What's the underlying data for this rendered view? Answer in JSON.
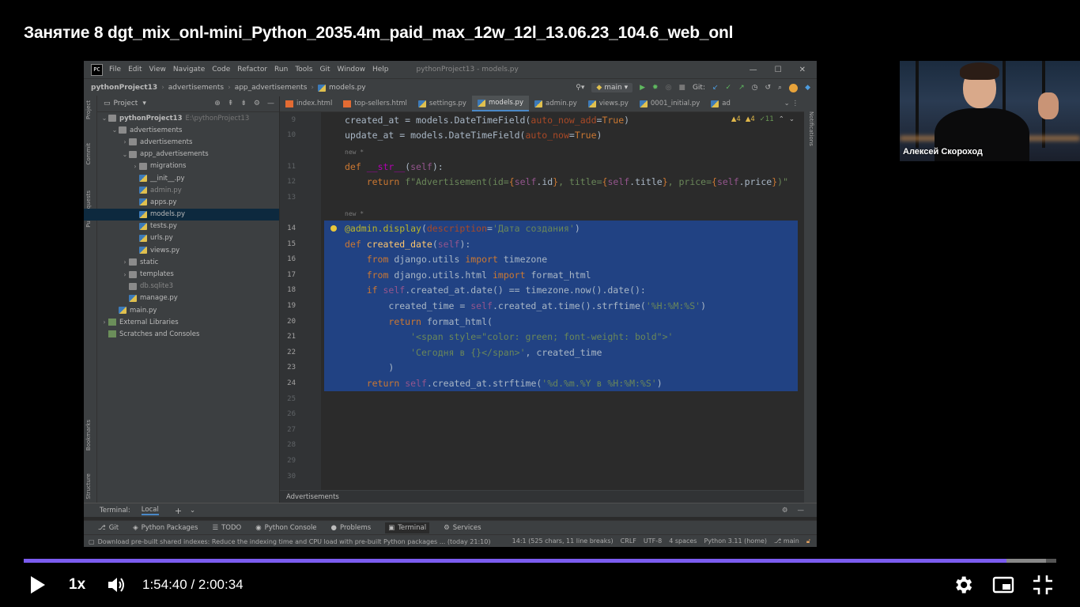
{
  "video": {
    "title": "Занятие 8 dgt_mix_onl-mini_Python_2035.4m_paid_max_12w_12l_13.06.23_104.6_web_onl",
    "speed": "1x",
    "time": "1:54:40 / 2:00:34",
    "progress_fraction": 0.952,
    "accent_color": "#7b5cf0"
  },
  "webcam": {
    "name": "Алексей Скороход"
  },
  "ide": {
    "menu": [
      "File",
      "Edit",
      "View",
      "Navigate",
      "Code",
      "Refactor",
      "Run",
      "Tools",
      "Git",
      "Window",
      "Help"
    ],
    "window_title": "pythonProject13 - models.py",
    "breadcrumbs": [
      "pythonProject13",
      "advertisements",
      "app_advertisements",
      "models.py"
    ],
    "branch": "main",
    "git_label": "Git:",
    "project_label": "Project",
    "left_tabs": [
      "Project",
      "Commit",
      "Pull Requests",
      "Bookmarks",
      "Structure"
    ],
    "right_tab": "Notifications",
    "tree": [
      {
        "label": "pythonProject13",
        "hint": "E:\\pythonProject13",
        "depth": 0,
        "type": "folder",
        "arrow": "v",
        "bold": true
      },
      {
        "label": "advertisements",
        "depth": 1,
        "type": "folder",
        "arrow": "v"
      },
      {
        "label": "advertisements",
        "depth": 2,
        "type": "folder",
        "arrow": ">"
      },
      {
        "label": "app_advertisements",
        "depth": 2,
        "type": "folder",
        "arrow": "v"
      },
      {
        "label": "migrations",
        "depth": 3,
        "type": "folder",
        "arrow": ">"
      },
      {
        "label": "__init__.py",
        "depth": 3,
        "type": "py"
      },
      {
        "label": "admin.py",
        "depth": 3,
        "type": "py",
        "grey": true
      },
      {
        "label": "apps.py",
        "depth": 3,
        "type": "py"
      },
      {
        "label": "models.py",
        "depth": 3,
        "type": "py",
        "selected": true
      },
      {
        "label": "tests.py",
        "depth": 3,
        "type": "py"
      },
      {
        "label": "urls.py",
        "depth": 3,
        "type": "py"
      },
      {
        "label": "views.py",
        "depth": 3,
        "type": "py"
      },
      {
        "label": "static",
        "depth": 2,
        "type": "folder",
        "arrow": ">"
      },
      {
        "label": "templates",
        "depth": 2,
        "type": "folder",
        "arrow": ">"
      },
      {
        "label": "db.sqlite3",
        "depth": 2,
        "type": "db",
        "grey": true
      },
      {
        "label": "manage.py",
        "depth": 2,
        "type": "py"
      },
      {
        "label": "main.py",
        "depth": 1,
        "type": "py"
      },
      {
        "label": "External Libraries",
        "depth": 0,
        "type": "lib",
        "arrow": ">"
      },
      {
        "label": "Scratches and Consoles",
        "depth": 0,
        "type": "lib"
      }
    ],
    "tabs": [
      {
        "label": "index.html",
        "kind": "html"
      },
      {
        "label": "top-sellers.html",
        "kind": "html"
      },
      {
        "label": "settings.py",
        "kind": "py"
      },
      {
        "label": "models.py",
        "kind": "py",
        "active": true
      },
      {
        "label": "admin.py",
        "kind": "py"
      },
      {
        "label": "views.py",
        "kind": "py"
      },
      {
        "label": "0001_initial.py",
        "kind": "py"
      },
      {
        "label": "ad",
        "kind": "py"
      }
    ],
    "inspections": {
      "warn1": "▲4",
      "warn2": "▲4",
      "ok": "✓11"
    },
    "code_lines": [
      {
        "n": "9",
        "html": "created_at = models.DateTimeField(<span class=\"param\">auto_now_add</span>=<span class=\"kw\">True</span>)"
      },
      {
        "n": "10",
        "html": "update_at = models.DateTimeField(<span class=\"param\">auto_now</span>=<span class=\"kw\">True</span>)"
      },
      {
        "n": "",
        "html": "<span class=\"inlay\">new *</span>"
      },
      {
        "n": "11",
        "html": "<span class=\"kw\">def</span> <span class=\"dunder\">__str__</span>(<span class=\"self\">self</span>):"
      },
      {
        "n": "12",
        "html": "    <span class=\"kw\">return</span> <span class=\"str\">f\"Advertisement(id=</span><span class=\"kw\">{</span><span class=\"self\">self</span>.id<span class=\"kw\">}</span><span class=\"str\">, title=</span><span class=\"kw\">{</span><span class=\"self\">self</span>.title<span class=\"kw\">}</span><span class=\"str\">, price=</span><span class=\"kw\">{</span><span class=\"self\">self</span>.price<span class=\"kw\">}</span><span class=\"str\">)\"</span>"
      },
      {
        "n": "13",
        "html": ""
      },
      {
        "n": "",
        "html": "<span class=\"inlay\">new *</span>"
      },
      {
        "n": "14",
        "html": "<span class=\"dec\">@admin.display</span>(<span class=\"param\">description</span>=<span class=\"str\">'Дата создания'</span>)",
        "hl": true,
        "bulb": true
      },
      {
        "n": "15",
        "html": "<span class=\"kw\">def</span> <span class=\"fn\">created_date</span>(<span class=\"self\">self</span>):",
        "hl": true
      },
      {
        "n": "16",
        "html": "    <span class=\"kw\">from</span> django.utils <span class=\"kw\">import</span> timezone",
        "hl": true
      },
      {
        "n": "17",
        "html": "    <span class=\"kw\">from</span> django.utils.html <span class=\"kw\">import</span> format_html",
        "hl": true
      },
      {
        "n": "18",
        "html": "    <span class=\"kw\">if</span> <span class=\"self\">self</span>.created_at.date() == timezone.now().date():",
        "hl": true
      },
      {
        "n": "19",
        "html": "        created_time = <span class=\"self\">self</span>.created_at.time().strftime(<span class=\"str\">'%H:%M:%S'</span>)",
        "hl": true
      },
      {
        "n": "20",
        "html": "        <span class=\"kw\">return</span> format_html(",
        "hl": true
      },
      {
        "n": "21",
        "html": "            <span class=\"str\">'&lt;span style=\"color: green; font-weight: bold\"&gt;'</span>",
        "hl": true
      },
      {
        "n": "22",
        "html": "            <span class=\"str\">'Сегодня в {}&lt;/span&gt;'</span>, created_time",
        "hl": true
      },
      {
        "n": "23",
        "html": "        )",
        "hl": true
      },
      {
        "n": "24",
        "html": "    <span class=\"kw\">return</span> <span class=\"self\">self</span>.created_at.strftime(<span class=\"str\">'%d.%m.%Y в %H:%M:%S'</span>)",
        "hl": true
      },
      {
        "n": "25",
        "html": ""
      },
      {
        "n": "26",
        "html": ""
      },
      {
        "n": "27",
        "html": ""
      },
      {
        "n": "28",
        "html": ""
      },
      {
        "n": "29",
        "html": ""
      },
      {
        "n": "30",
        "html": ""
      }
    ],
    "editor_breadcrumb": "Advertisements",
    "terminal": {
      "label": "Terminal:",
      "tab": "Local",
      "add": "+",
      "chevron": "⌄"
    },
    "tool_windows": [
      "Git",
      "Python Packages",
      "TODO",
      "Python Console",
      "Problems",
      "Terminal",
      "Services"
    ],
    "tool_window_icons": [
      "⎇",
      "◈",
      "☰",
      "◉",
      "●",
      "▣",
      "⚙"
    ],
    "status": {
      "message": "Download pre-built shared indexes: Reduce the indexing time and CPU load with pre-built Python packages ... (today 21:10)",
      "position": "14:1 (525 chars, 11 line breaks)",
      "line_sep": "CRLF",
      "encoding": "UTF-8",
      "indent": "4 spaces",
      "interpreter": "Python 3.11 (home)",
      "branch": "main"
    }
  }
}
